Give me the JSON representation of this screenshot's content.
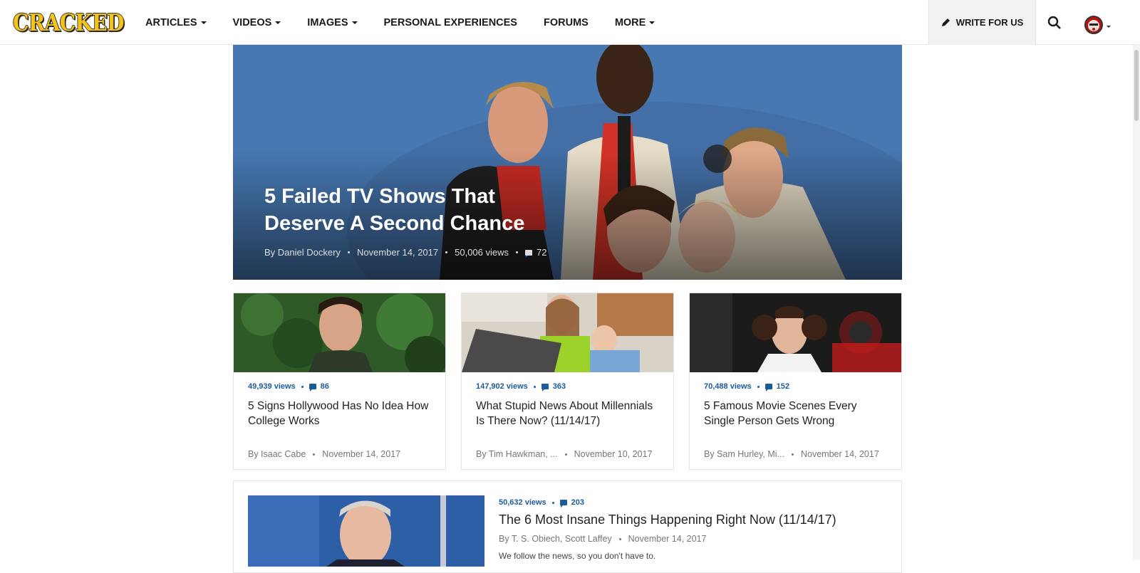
{
  "header": {
    "logo": "CRACKED",
    "nav": [
      {
        "label": "ARTICLES",
        "dropdown": true
      },
      {
        "label": "VIDEOS",
        "dropdown": true
      },
      {
        "label": "IMAGES",
        "dropdown": true
      },
      {
        "label": "PERSONAL EXPERIENCES",
        "dropdown": false
      },
      {
        "label": "FORUMS",
        "dropdown": false
      },
      {
        "label": "MORE",
        "dropdown": true
      }
    ],
    "write_label": "WRITE FOR US",
    "icons": {
      "write": "pencil-icon",
      "search": "search-icon",
      "avatar": "user-avatar"
    }
  },
  "hero": {
    "title": "5 Failed TV Shows That Deserve A Second Chance",
    "author": "By Daniel Dockery",
    "date": "November 14, 2017",
    "views": "50,006 views",
    "comments": "72"
  },
  "cards": [
    {
      "views": "49,939 views",
      "comments": "86",
      "title": "5 Signs Hollywood Has No Idea How College Works",
      "author": "By Isaac Cabe",
      "date": "November 14, 2017"
    },
    {
      "views": "147,902 views",
      "comments": "363",
      "title": "What Stupid News About Millennials Is There Now? (11/14/17)",
      "author": "By Tim Hawkman, ...",
      "date": "November 10, 2017"
    },
    {
      "views": "70,488 views",
      "comments": "152",
      "title": "5 Famous Movie Scenes Every Single Person Gets Wrong",
      "author": "By Sam Hurley, Mi...",
      "date": "November 14, 2017"
    }
  ],
  "wide": {
    "views": "50,632 views",
    "comments": "203",
    "title": "The 6 Most Insane Things Happening Right Now (11/14/17)",
    "author": "By T. S. Obiech, Scott Laffey",
    "date": "November 14, 2017",
    "desc": "We follow the news, so you don't have to."
  },
  "colors": {
    "brand": "#f4c31b",
    "link": "#1c5a9c"
  }
}
